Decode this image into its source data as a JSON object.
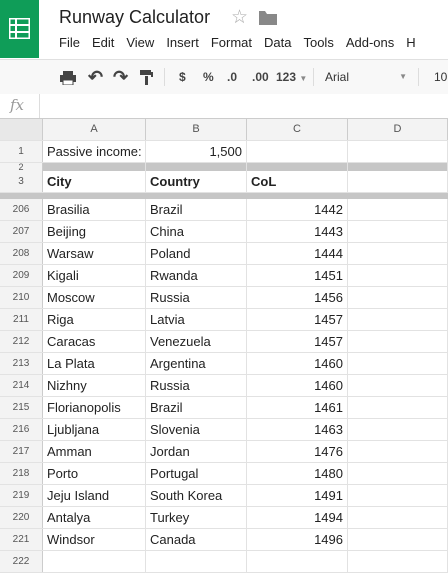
{
  "app": {
    "title": "Runway Calculator",
    "menu": [
      "File",
      "Edit",
      "View",
      "Insert",
      "Format",
      "Data",
      "Tools",
      "Add-ons",
      "H"
    ]
  },
  "toolbar": {
    "currency": "$",
    "percent": "%",
    "decrease_decimals": ".0",
    "increase_decimals": ".00",
    "more_formats": "123",
    "font": "Arial",
    "font_size": "10"
  },
  "formula_bar": {
    "icon": "fx",
    "value": ""
  },
  "colors": {
    "brand_green": "#0f9d58"
  },
  "columns": [
    "A",
    "B",
    "C",
    "D"
  ],
  "passive_row": {
    "num": "1",
    "label": "Passive income:",
    "value": "1,500"
  },
  "row2_num": "2",
  "header_row": {
    "num": "3",
    "city": "City",
    "country": "Country",
    "col": "CoL"
  },
  "rows": [
    {
      "num": "206",
      "city": "Brasilia",
      "country": "Brazil",
      "col": "1442"
    },
    {
      "num": "207",
      "city": "Beijing",
      "country": "China",
      "col": "1443"
    },
    {
      "num": "208",
      "city": "Warsaw",
      "country": "Poland",
      "col": "1444"
    },
    {
      "num": "209",
      "city": "Kigali",
      "country": "Rwanda",
      "col": "1451"
    },
    {
      "num": "210",
      "city": "Moscow",
      "country": "Russia",
      "col": "1456"
    },
    {
      "num": "211",
      "city": "Riga",
      "country": "Latvia",
      "col": "1457"
    },
    {
      "num": "212",
      "city": "Caracas",
      "country": "Venezuela",
      "col": "1457"
    },
    {
      "num": "213",
      "city": "La Plata",
      "country": "Argentina",
      "col": "1460"
    },
    {
      "num": "214",
      "city": "Nizhny",
      "country": "Russia",
      "col": "1460"
    },
    {
      "num": "215",
      "city": "Florianopolis",
      "country": "Brazil",
      "col": "1461"
    },
    {
      "num": "216",
      "city": "Ljubljana",
      "country": "Slovenia",
      "col": "1463"
    },
    {
      "num": "217",
      "city": "Amman",
      "country": "Jordan",
      "col": "1476"
    },
    {
      "num": "218",
      "city": "Porto",
      "country": "Portugal",
      "col": "1480"
    },
    {
      "num": "219",
      "city": "Jeju Island",
      "country": "South Korea",
      "col": "1491"
    },
    {
      "num": "220",
      "city": "Antalya",
      "country": "Turkey",
      "col": "1494"
    },
    {
      "num": "221",
      "city": "Windsor",
      "country": "Canada",
      "col": "1496"
    },
    {
      "num": "222",
      "city": "",
      "country": "",
      "col": ""
    }
  ]
}
